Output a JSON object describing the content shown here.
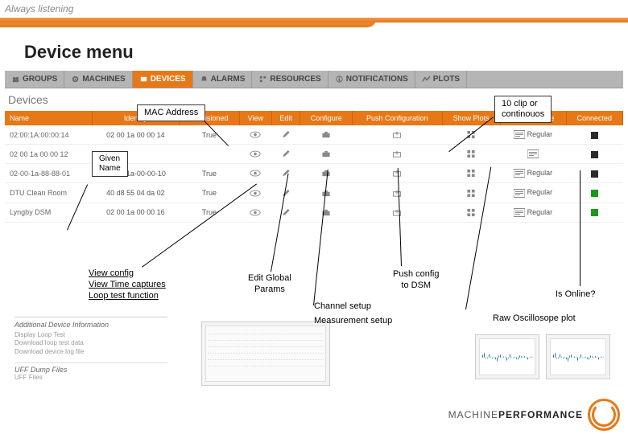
{
  "tagline": "Always listening",
  "page_title": "Device menu",
  "navbar": [
    {
      "label": "GROUPS",
      "active": false
    },
    {
      "label": "MACHINES",
      "active": false
    },
    {
      "label": "DEVICES",
      "active": true
    },
    {
      "label": "ALARMS",
      "active": false
    },
    {
      "label": "RESOURCES",
      "active": false
    },
    {
      "label": "NOTIFICATIONS",
      "active": false
    },
    {
      "label": "PLOTS",
      "active": false
    }
  ],
  "section_label": "Devices",
  "table": {
    "columns": [
      "Name",
      "Identity",
      "Provisioned",
      "View",
      "Edit",
      "Configure",
      "Push Configuration",
      "Show Plots",
      "License Type",
      "Connected"
    ],
    "rows": [
      {
        "name": "02:00:1A:00:00:14",
        "identity": "02 00 1a 00 00 14",
        "provisioned": "True",
        "license": "Regular",
        "connected": "#2a2a2a"
      },
      {
        "name": "02 00 1a 00 00 12",
        "identity": "",
        "provisioned": "",
        "license": "",
        "connected": "#2a2a2a"
      },
      {
        "name": "02-00-1a-88-88-01",
        "identity": "02-00-1a-00-00-10",
        "provisioned": "True",
        "license": "Regular",
        "connected": "#2a2a2a"
      },
      {
        "name": "DTU Clean Room",
        "identity": "40 d8 55 04 da 02",
        "provisioned": "True",
        "license": "Regular",
        "connected": "#1a9a1a"
      },
      {
        "name": "Lyngby DSM",
        "identity": "02 00 1a 00 00 16",
        "provisioned": "True",
        "license": "Regular",
        "connected": "#1a9a1a"
      }
    ]
  },
  "callouts": {
    "mac": "MAC Address",
    "license": "10 clip or\ncontinouos",
    "given_name": "Given\nName"
  },
  "annotations": {
    "view_config": "View config",
    "view_time": "View Time captures",
    "loop_test": "Loop test function",
    "edit_global": "Edit Global\nParams",
    "push_config": "Push config\nto DSM",
    "channel_setup": "Channel setup",
    "measurement_setup": "Measurement setup",
    "is_online": "Is Online?",
    "raw_osc": "Raw Oscillosope plot"
  },
  "additional_panel": {
    "header": "Additional Device Information",
    "links": [
      "Display Loop Test",
      "Download loop test data",
      "Download device log file"
    ],
    "sub_header": "UFF Dump Files",
    "sub_link": "UFF Files"
  },
  "footer": {
    "brand_main": "MACHINE",
    "brand_bold": "PERFORMANCE"
  }
}
